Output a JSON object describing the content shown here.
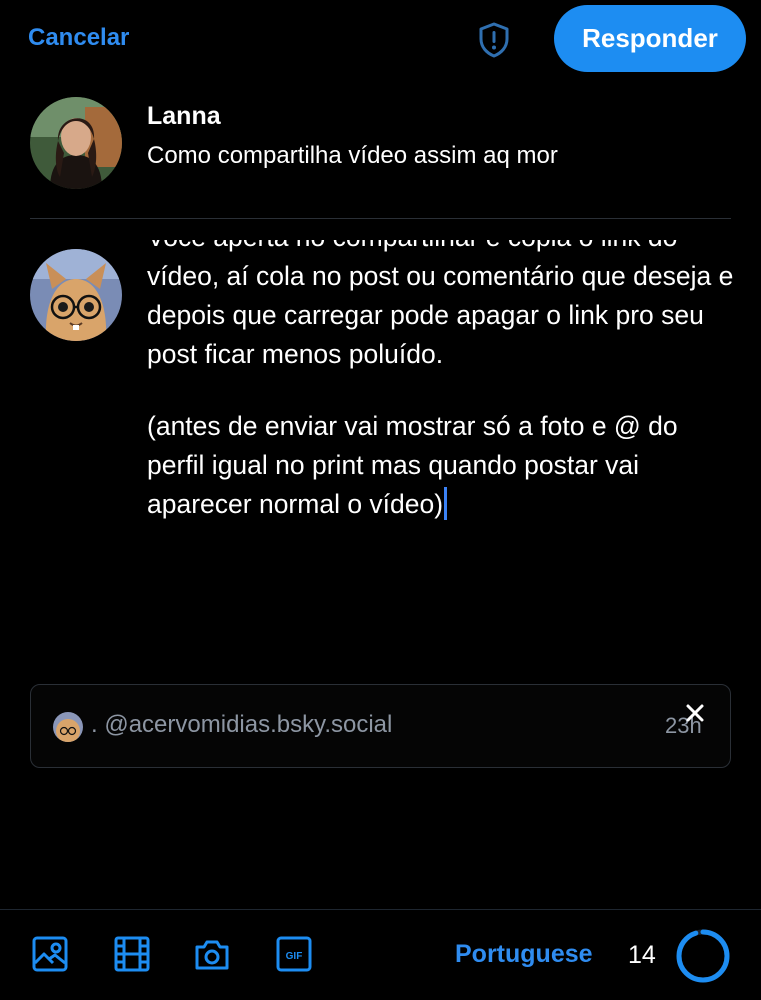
{
  "header": {
    "cancel_label": "Cancelar",
    "reply_label": "Responder",
    "moderation_icon": "shield-alert-icon"
  },
  "parent_post": {
    "author": "Lanna",
    "text": "Como compartilha vídeo assim aq mor"
  },
  "composer": {
    "paragraphs": [
      "Você aperta no compartilhar e copia o link do vídeo, aí cola no post ou comentário que deseja e depois que carregar pode apagar o link pro seu post ficar menos poluído.",
      "(antes de enviar vai mostrar só a foto e @ do perfil igual no print mas quando postar vai aparecer normal o vídeo)"
    ]
  },
  "embed": {
    "separator": ".",
    "handle": "@acervomidias.bsky.social",
    "time": "23h"
  },
  "toolbar": {
    "icons": [
      "image-icon",
      "video-icon",
      "camera-icon",
      "gif-icon"
    ],
    "language": "Portuguese",
    "remaining_count": "14",
    "char_limit_progress": 0.95
  },
  "colors": {
    "accent": "#1d8df2",
    "background": "#000000",
    "muted_text": "#8d96a3",
    "border": "#2a2f36"
  }
}
